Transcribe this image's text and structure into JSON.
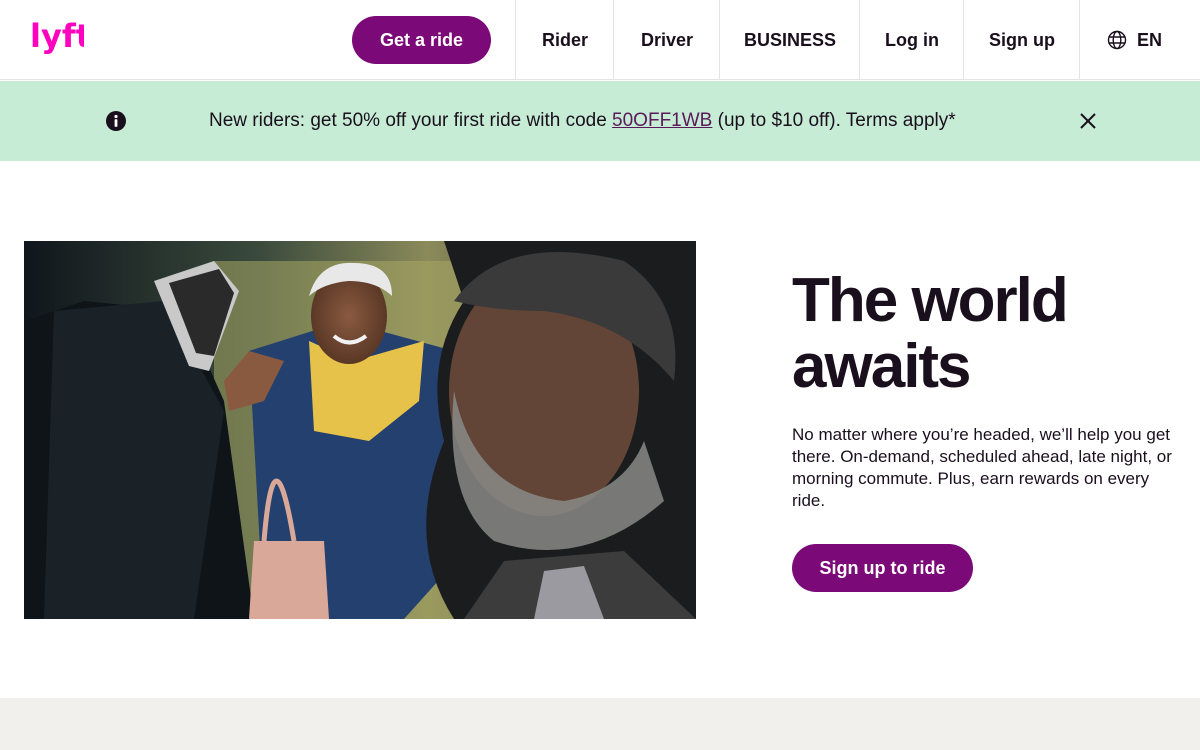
{
  "brand": {
    "logo_text": "lyft",
    "accent_color": "#7b0a78",
    "logo_color": "#ff00bf"
  },
  "header": {
    "cta_label": "Get a ride",
    "nav": [
      {
        "label": "Rider"
      },
      {
        "label": "Driver"
      },
      {
        "label": "BUSINESS"
      },
      {
        "label": "Log in"
      },
      {
        "label": "Sign up"
      }
    ],
    "language": {
      "icon": "globe-icon",
      "label": "EN"
    }
  },
  "promo": {
    "icon": "info-icon",
    "text_before": "New riders: get 50% off your first ride with code ",
    "code": "50OFF1WB",
    "text_after": " (up to $10 off). Terms apply*",
    "close_icon": "close-icon",
    "background": "#c7ecd6"
  },
  "hero": {
    "title": "The world awaits",
    "body": "No matter where you’re headed, we’ll help you get there. On-demand, scheduled ahead, late night, or morning commute. Plus, earn rewards on every ride.",
    "cta_label": "Sign up to ride"
  }
}
